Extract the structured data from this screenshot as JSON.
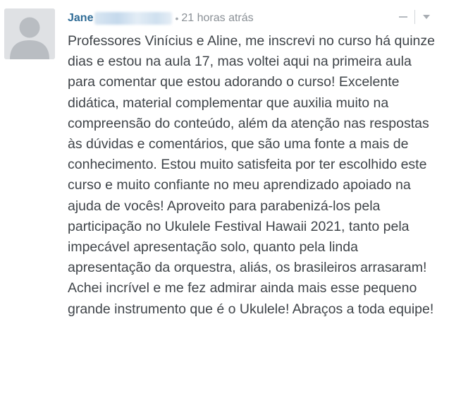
{
  "comment": {
    "author": "Jane",
    "bullet": "•",
    "timestamp": "21 horas atrás",
    "text": "Professores Vinícius e Aline, me inscrevi no curso há quinze dias e estou na aula 17, mas voltei aqui na primeira aula para comentar que estou adorando o curso! Excelente didática, material complementar que auxilia muito na compreensão do conteúdo, além da atenção nas respostas às dúvidas e comentários, que são uma fonte a mais de conhecimento. Estou muito satisfeita por ter escolhido este curso e muito confiante no meu aprendizado apoiado na ajuda de vocês! Aproveito para parabenizá-los pela participação no Ukulele Festival Hawaii 2021, tanto pela impecável apresentação solo, quanto pela linda apresentação da orquestra, aliás, os brasileiros arrasaram! Achei incrível e me fez admirar ainda mais esse pequeno grande instrumento que é o Ukulele! Abraços a toda equipe!"
  },
  "icons": {
    "avatar": "default-user-avatar-icon",
    "collapse": "minus-collapse-icon",
    "menu": "chevron-down-icon"
  },
  "colors": {
    "author": "#2e6b96",
    "timestamp": "#8a9096",
    "body_text": "#3f4449",
    "avatar_bg": "#dfe1e4",
    "avatar_fg": "#b9bdc2"
  }
}
